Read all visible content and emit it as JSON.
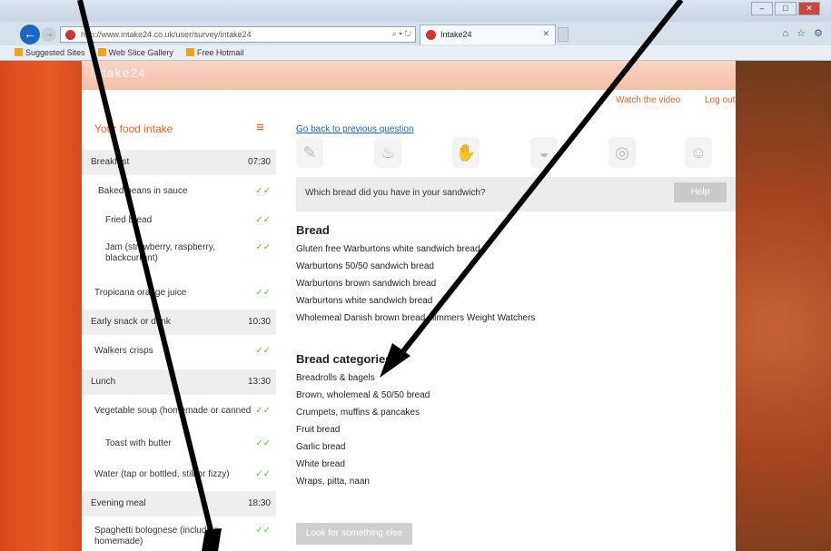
{
  "browser": {
    "url": "http://www.intake24.co.uk/user/survey/intake24",
    "tab_title": "Intake24",
    "favorites": [
      "Suggested Sites",
      "Web Slice Gallery",
      "Free Hotmail"
    ],
    "win_controls": [
      "–",
      "□",
      "✕"
    ],
    "tools": "⌂ ☆ ⚙"
  },
  "header": {
    "brand": "intake24",
    "watch_video": "Watch the video",
    "logout": "Log out"
  },
  "sidebar": {
    "title": "Your food intake",
    "menu_icon": "≡",
    "rows": [
      {
        "label": "Breakfast",
        "value": "07:30",
        "type": "meal"
      },
      {
        "label": "Baked beans in sauce",
        "value": "✓✓",
        "type": "food"
      },
      {
        "label": "Fried bread",
        "value": "✓✓",
        "type": "food"
      },
      {
        "label": "Jam (strawberry, raspberry, blackcurrant)",
        "value": "✓✓",
        "type": "food"
      },
      {
        "label": "Tropicana orange juice",
        "value": "✓✓",
        "type": "food"
      },
      {
        "label": "Early snack or drink",
        "value": "10:30",
        "type": "meal"
      },
      {
        "label": "Walkers crisps",
        "value": "✓✓",
        "type": "food"
      },
      {
        "label": "Lunch",
        "value": "13:30",
        "type": "meal"
      },
      {
        "label": "Vegetable soup (homemade or canned)",
        "value": "✓✓",
        "type": "food"
      },
      {
        "label": "Toast with butter",
        "value": "✓✓",
        "type": "food"
      },
      {
        "label": "Water (tap or bottled, still or fizzy)",
        "value": "✓✓",
        "type": "food"
      },
      {
        "label": "Evening meal",
        "value": "18:30",
        "type": "meal"
      },
      {
        "label": "Spaghetti bolognese (including homemade)",
        "value": "✓✓",
        "type": "food"
      }
    ]
  },
  "main": {
    "back_link": "Go back to previous question",
    "step_icons": [
      "pencil-icon",
      "food-icon",
      "hand-icon",
      "bowl-icon",
      "plate-icon",
      "chef-icon"
    ],
    "question": "Which bread did you have in your sandwich?",
    "help_label": "Help",
    "bread_title": "Bread",
    "bread_items": [
      "Gluten free Warburtons white sandwich bread",
      "Warburtons 50/50 sandwich bread",
      "Warburtons brown sandwich bread",
      "Warburtons white sandwich bread",
      "Wholemeal Danish brown bread slimmers Weight Watchers"
    ],
    "category_title": "Bread categories",
    "category_items": [
      "Breadrolls & bagels",
      "Brown, wholemeal & 50/50 bread",
      "Crumpets, muffins & pancakes",
      "Fruit bread",
      "Garlic bread",
      "White bread",
      "Wraps, pitta, naan"
    ],
    "next_button": "Look for something else"
  }
}
